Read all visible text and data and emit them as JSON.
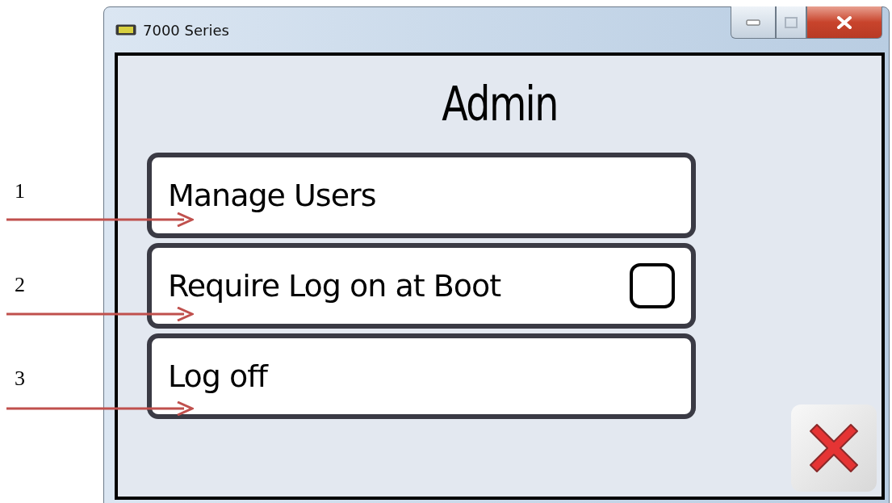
{
  "window": {
    "title": "7000 Series"
  },
  "heading": "Admin",
  "menu_items": [
    {
      "kind": "button",
      "label": "Manage Users"
    },
    {
      "kind": "checkbox",
      "label": "Require Log on at Boot",
      "checked": false
    },
    {
      "kind": "button",
      "label": "Log off"
    }
  ],
  "annotations": [
    "1",
    "2",
    "3"
  ]
}
